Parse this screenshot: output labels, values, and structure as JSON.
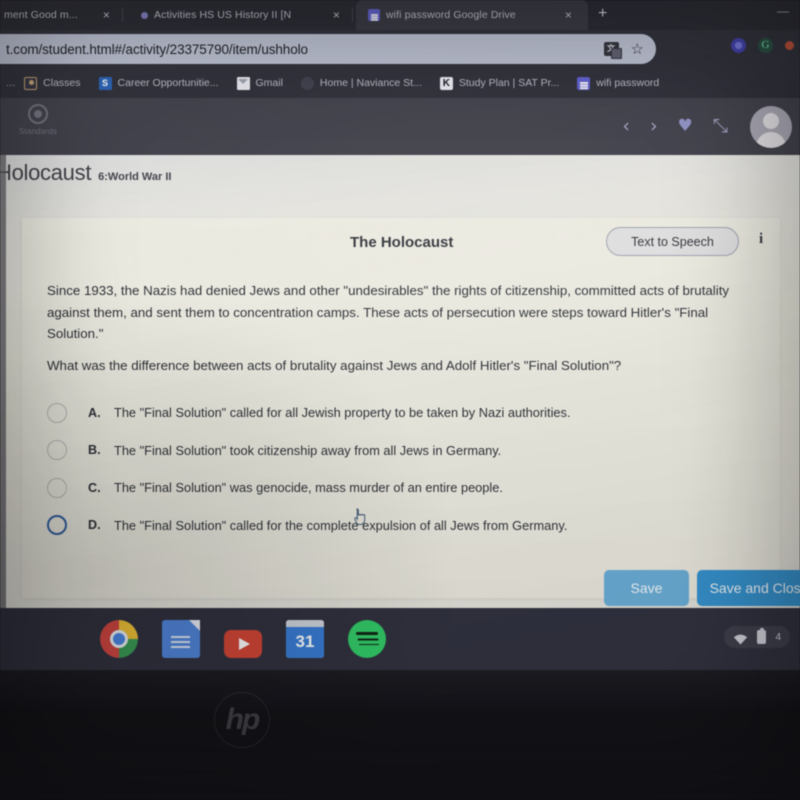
{
  "browser": {
    "tabs": [
      {
        "title": "ment  Good m...",
        "favicon": "none-icon",
        "close_label": "×",
        "active": false
      },
      {
        "title": "Activities  HS US History II [N",
        "favicon": "dot-icon",
        "close_label": "×",
        "active": false
      },
      {
        "title": "wifi password  Google Drive",
        "favicon": "google-docs-icon",
        "close_label": "×",
        "active": true
      }
    ],
    "new_tab_label": "+",
    "window_controls": "—",
    "omnibox": {
      "url": "t.com/student.html#/activity/23375790/item/ushholo",
      "placeholder": "Search Google or type a URL",
      "translate_icon": "translate-icon",
      "translate_glyph": "文",
      "star_icon": "bookmark-star-icon",
      "star_glyph": "☆"
    },
    "extensions": [
      {
        "name": "pinwheel-extension-icon"
      },
      {
        "name": "grammarly-extension-icon",
        "glyph": "G"
      },
      {
        "name": "red-dot-extension-icon"
      }
    ],
    "bookmarks": [
      {
        "label": "Classes",
        "icon": "classes-icon"
      },
      {
        "label": "Career Opportunitie...",
        "icon": "scoir-icon",
        "glyph": "S"
      },
      {
        "label": "Gmail",
        "icon": "gmail-icon"
      },
      {
        "label": "Home | Naviance St...",
        "icon": "naviance-icon"
      },
      {
        "label": "Study Plan | SAT Pr...",
        "icon": "khan-academy-icon",
        "glyph": "K"
      },
      {
        "label": "wifi password",
        "icon": "google-docs-icon"
      }
    ],
    "bookmark_overflow": "..."
  },
  "app_header": {
    "standards_button": {
      "label": "Standards",
      "icon": "target-icon"
    },
    "actions": [
      {
        "name": "previous-item-button",
        "glyph": "‹"
      },
      {
        "name": "next-item-button",
        "glyph": "›"
      },
      {
        "name": "favorite-button",
        "glyph": "♥"
      },
      {
        "name": "fullscreen-button",
        "glyph": "⤡"
      }
    ],
    "avatar": "user-avatar"
  },
  "page": {
    "title": "Holocaust",
    "subtitle": "6:World War II"
  },
  "card": {
    "heading": "The Holocaust",
    "text_to_speech_label": "Text to Speech",
    "info_glyph": "i",
    "book_icon": "open-book-icon",
    "passage": "Since 1933, the Nazis had denied Jews and other \"undesirables\" the rights of citizenship, committed acts of brutality against them, and sent them to concentration camps. These acts of persecution were steps toward Hitler's \"Final Solution.\"",
    "question": "What was the difference between acts of brutality against Jews and Adolf Hitler's \"Final Solution\"?",
    "choices": [
      {
        "letter": "A.",
        "text": "The \"Final Solution\" called for all Jewish property to be taken by Nazi authorities.",
        "selected": false,
        "hover": false
      },
      {
        "letter": "B.",
        "text": "The \"Final Solution\" took citizenship away from all Jews in Germany.",
        "selected": false,
        "hover": false
      },
      {
        "letter": "C.",
        "text": "The \"Final Solution\" was genocide, mass murder of an entire people.",
        "selected": false,
        "hover": false
      },
      {
        "letter": "D.",
        "text": "The \"Final Solution\" called for the complete expulsion of all Jews from Germany.",
        "selected": false,
        "hover": true
      }
    ]
  },
  "footer": {
    "save_label": "Save",
    "save_and_close_label": "Save and Close"
  },
  "shelf": {
    "apps": [
      {
        "name": "chrome-app-icon"
      },
      {
        "name": "google-docs-app-icon"
      },
      {
        "name": "youtube-app-icon"
      },
      {
        "name": "google-calendar-app-icon",
        "label": "31"
      },
      {
        "name": "spotify-app-icon"
      }
    ],
    "tray": {
      "wifi_icon": "wifi-icon",
      "battery_icon": "battery-icon",
      "battery_text": "4"
    }
  },
  "device": {
    "brand": "hp"
  },
  "colors": {
    "browser_chrome": "#2b2b36",
    "app_header": "#3c3c48",
    "page_bg": "#eceade",
    "save_button": "#62aedd",
    "save_close_button": "#2a93d8",
    "radio_hover": "#2b5fa8",
    "shelf": "#2e2f3e"
  }
}
